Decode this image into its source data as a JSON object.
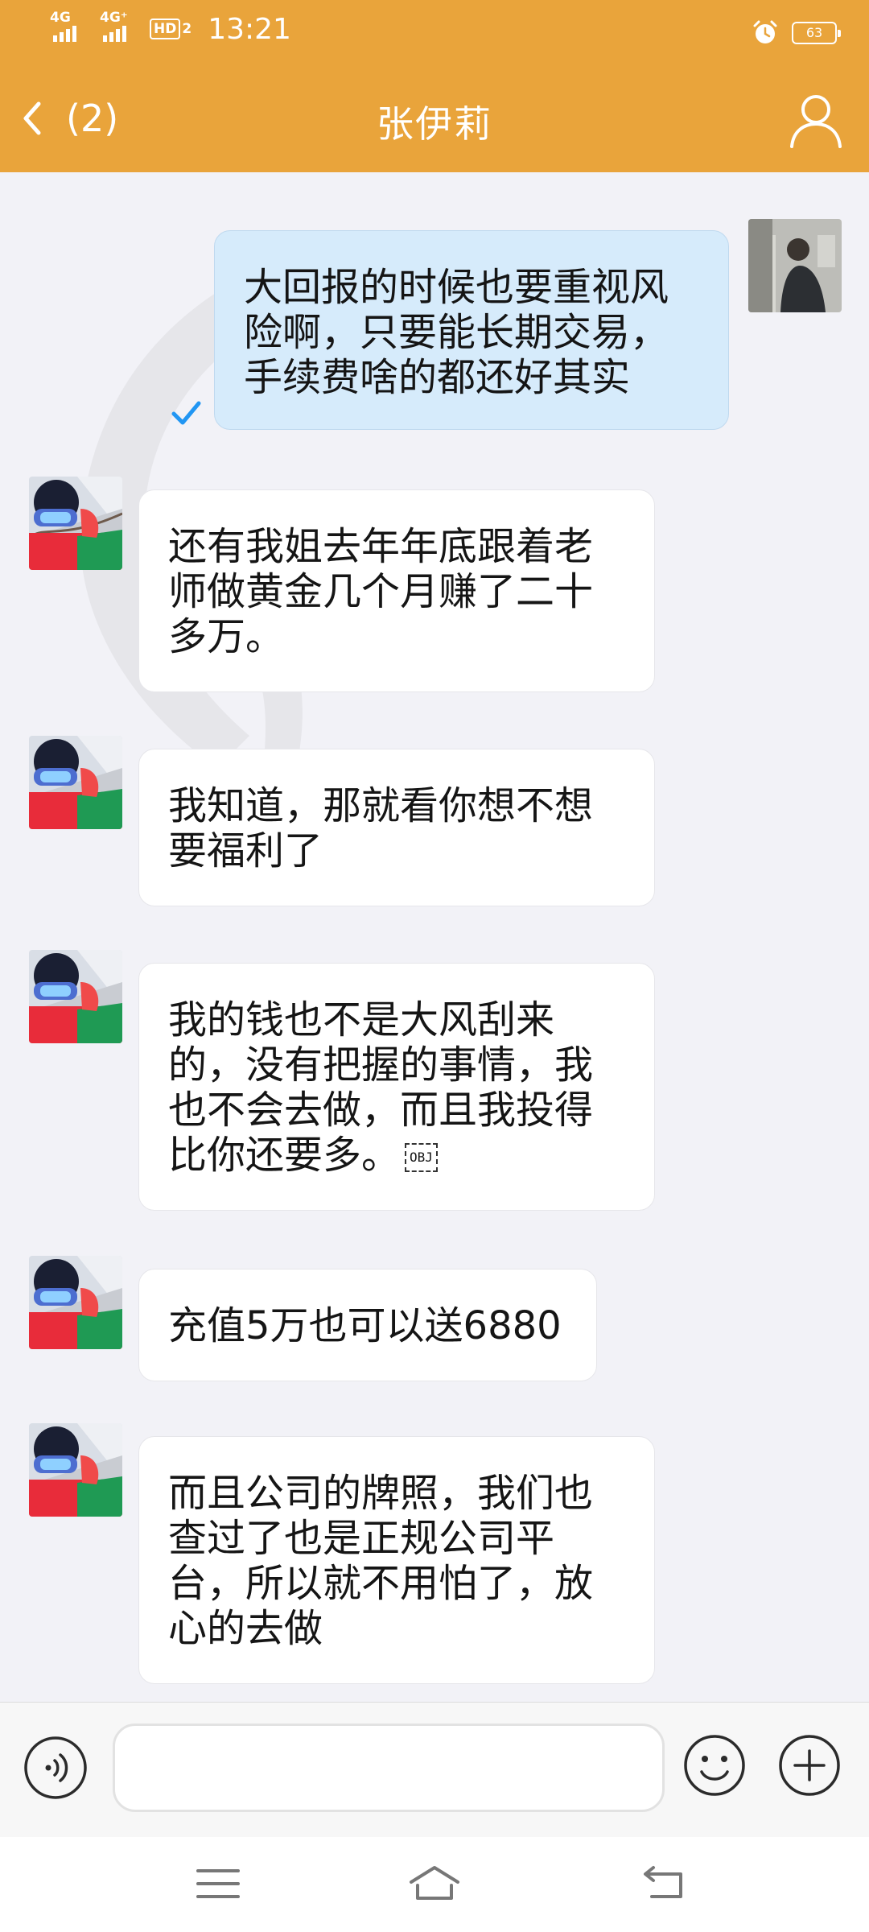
{
  "status_bar": {
    "network_1": "4G",
    "network_2": "4G⁺",
    "hd_label": "HD",
    "hd_sub": "2",
    "time": "13:21",
    "battery_level": "63",
    "icons": [
      "signal-bars-icon",
      "hd-voice-icon",
      "alarm-icon",
      "battery-icon"
    ]
  },
  "header": {
    "back_icon": "chevron-left-icon",
    "unread_count": "(2)",
    "title": "张伊莉",
    "profile_icon": "person-icon",
    "background_color": "#e9a43b"
  },
  "messages": [
    {
      "direction": "outgoing",
      "text": "大回报的时候也要重视风险啊，只要能长期交易，手续费啥的都还好其实",
      "status": "read",
      "status_icon": "checkmark-icon",
      "avatar": "user-avatar-photo"
    },
    {
      "direction": "incoming",
      "text": "还有我姐去年年底跟着老师做黄金几个月赚了二十多万。",
      "avatar": "contact-avatar-ski"
    },
    {
      "direction": "incoming",
      "text": "我知道，那就看你想不想要福利了",
      "avatar": "contact-avatar-ski"
    },
    {
      "direction": "incoming",
      "text": "我的钱也不是大风刮来的，没有把握的事情，我也不会去做，而且我投得比你还要多。",
      "object_marker": "OBJ",
      "avatar": "contact-avatar-ski"
    },
    {
      "direction": "incoming",
      "text": "充值5万也可以送6880",
      "avatar": "contact-avatar-ski"
    },
    {
      "direction": "incoming",
      "text": "而且公司的牌照，我们也查过了也是正规公司平台，所以就不用怕了，放心的去做",
      "avatar": "contact-avatar-ski"
    }
  ],
  "input_bar": {
    "voice_icon": "voice-wave-icon",
    "input_value": "",
    "emoji_icon": "smiley-icon",
    "plus_icon": "plus-circle-icon"
  },
  "system_nav": {
    "icons": [
      "menu-icon",
      "home-icon",
      "back-arrow-icon"
    ]
  },
  "colors": {
    "accent": "#e9a43b",
    "outgoing_bubble": "#d6ebfb",
    "incoming_bubble": "#ffffff",
    "chat_background": "#f2f2f7",
    "read_check": "#2196f3"
  }
}
